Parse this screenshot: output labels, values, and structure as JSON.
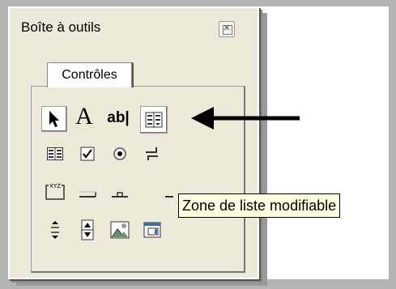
{
  "window": {
    "title": "Boîte à outils",
    "close_icon": "close-icon"
  },
  "tabs": [
    {
      "label": "Contrôles",
      "active": true
    }
  ],
  "controls": [
    {
      "name": "pointer-icon",
      "selected": true
    },
    {
      "name": "label-text-icon",
      "glyph": "A"
    },
    {
      "name": "textbox-icon",
      "glyph": "ab|"
    },
    {
      "name": "combobox-icon",
      "selected": true
    },
    {
      "name": "listbox-icon"
    },
    {
      "name": "checkbox-icon"
    },
    {
      "name": "option-button-icon"
    },
    {
      "name": "toggle-button-icon"
    },
    {
      "name": "frame-icon",
      "glyph": "XYZ"
    },
    {
      "name": "command-button-icon"
    },
    {
      "name": "tabstrip-icon"
    },
    {
      "name": "multipage-icon"
    },
    {
      "name": "scrollbar-icon"
    },
    {
      "name": "spinbutton-icon"
    },
    {
      "name": "image-icon"
    },
    {
      "name": "refedit-icon"
    }
  ],
  "tooltip": {
    "text": "Zone de liste modifiable"
  },
  "annotation": {
    "arrow": "arrow-left-icon"
  }
}
